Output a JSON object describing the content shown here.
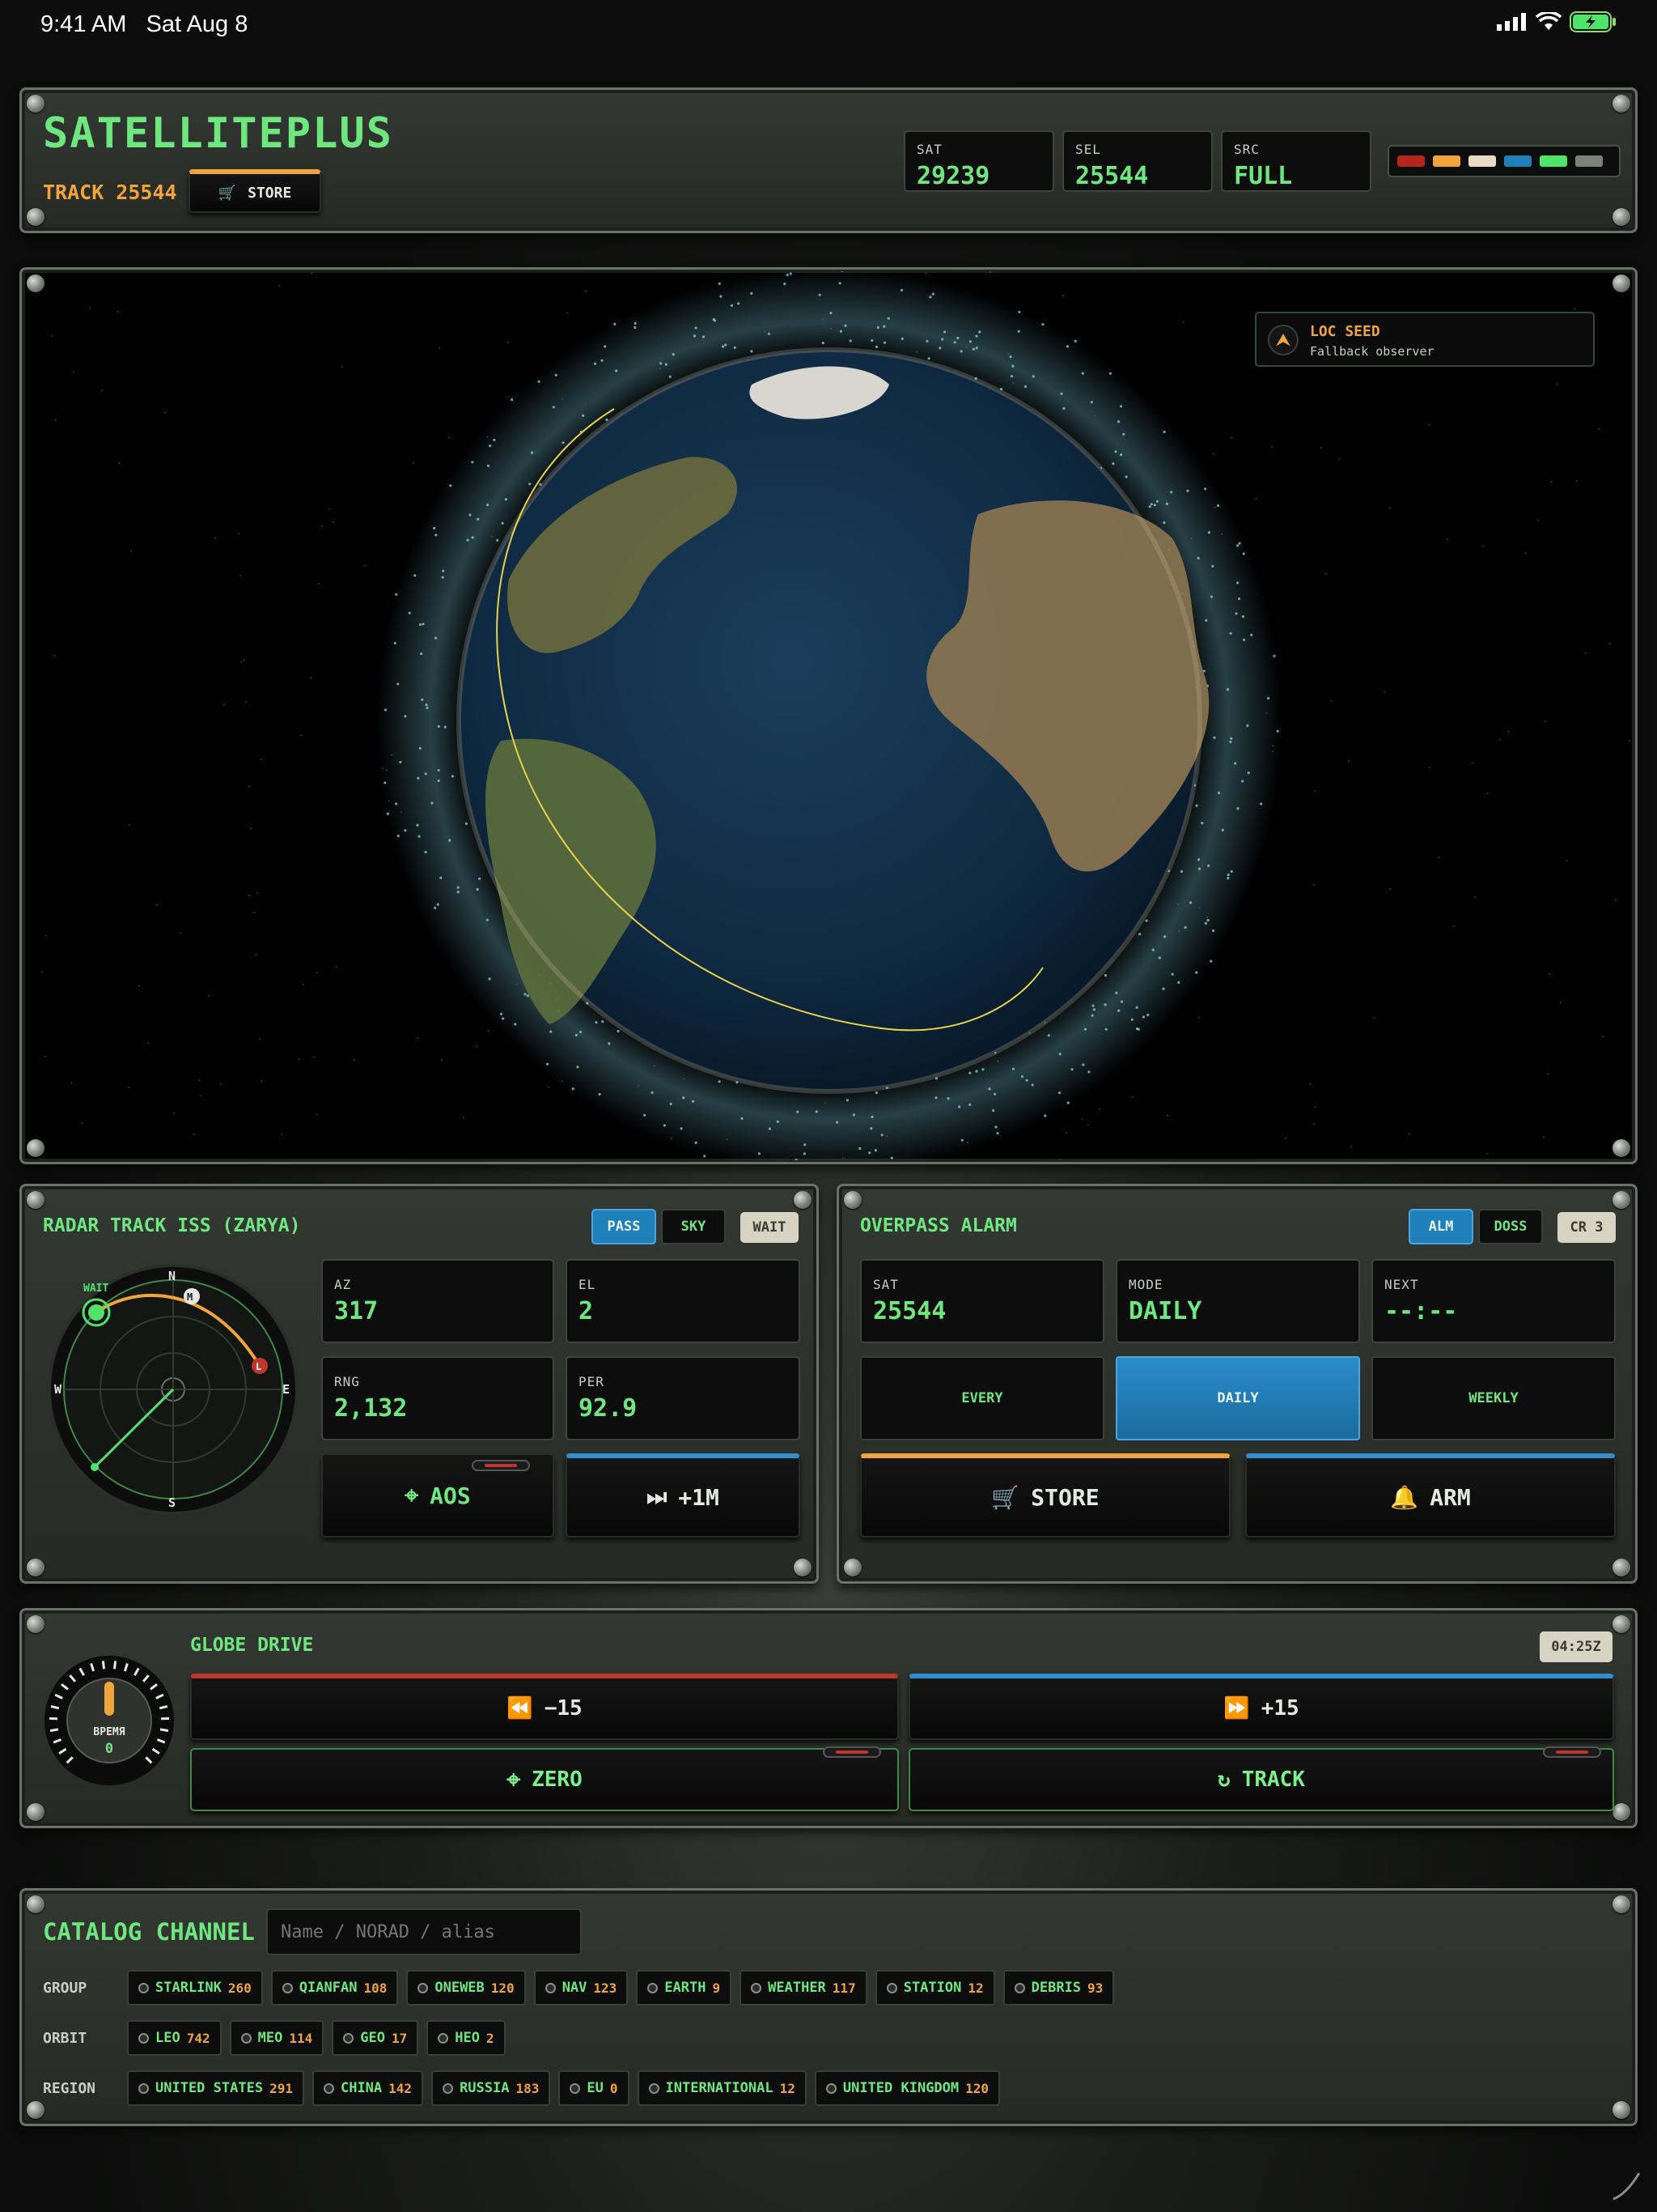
{
  "status": {
    "time": "9:41 AM",
    "date": "Sat Aug 8"
  },
  "header": {
    "app_title": "SATELLITEPLUS",
    "track_label": "TRACK 25544",
    "store_label": "STORE",
    "stats": [
      {
        "label": "SAT",
        "value": "29239"
      },
      {
        "label": "SEL",
        "value": "25544"
      },
      {
        "label": "SRC",
        "value": "FULL"
      }
    ],
    "palette": [
      "#b3261e",
      "#f0a43c",
      "#e7dcc1",
      "#1f7fb8",
      "#4fe36a",
      "#7b8378"
    ]
  },
  "globe": {
    "loc_title": "LOC SEED",
    "loc_sub": "Fallback observer"
  },
  "radar": {
    "title": "RADAR TRACK ISS (ZARYA)",
    "tabs": [
      "PASS",
      "SKY"
    ],
    "status_badge": "WAIT",
    "compass": {
      "n": "N",
      "e": "E",
      "s": "S",
      "w": "W",
      "marker_m": "M",
      "marker_l": "L",
      "wait_label": "WAIT"
    },
    "readouts": [
      {
        "label": "AZ",
        "value": "317"
      },
      {
        "label": "EL",
        "value": "2"
      },
      {
        "label": "RNG",
        "value": "2,132"
      },
      {
        "label": "PER",
        "value": "92.9"
      }
    ],
    "aos_label": "AOS",
    "plus1m_label": "+1M"
  },
  "alarm": {
    "title": "OVERPASS ALARM",
    "tabs": [
      "ALM",
      "DOSS"
    ],
    "badge": "CR 3",
    "readouts": [
      {
        "label": "SAT",
        "value": "25544"
      },
      {
        "label": "MODE",
        "value": "DAILY"
      },
      {
        "label": "NEXT",
        "value": "--:--"
      }
    ],
    "modes": [
      "EVERY",
      "DAILY",
      "WEEKLY"
    ],
    "store_label": "STORE",
    "arm_label": "ARM"
  },
  "drive": {
    "title": "GLOBE DRIVE",
    "time_badge": "04:25Z",
    "knob_label": "ВРЕМЯ",
    "knob_value": "0",
    "back_label": "−15",
    "fwd_label": "+15",
    "zero_label": "ZERO",
    "track_label": "TRACK"
  },
  "catalog": {
    "title": "CATALOG CHANNEL",
    "search_placeholder": "Name / NORAD / alias",
    "groups_label": "GROUP",
    "groups": [
      {
        "name": "STARLINK",
        "count": "260"
      },
      {
        "name": "QIANFAN",
        "count": "108"
      },
      {
        "name": "ONEWEB",
        "count": "120"
      },
      {
        "name": "NAV",
        "count": "123"
      },
      {
        "name": "EARTH",
        "count": "9"
      },
      {
        "name": "WEATHER",
        "count": "117"
      },
      {
        "name": "STATION",
        "count": "12"
      },
      {
        "name": "DEBRIS",
        "count": "93"
      }
    ],
    "orbit_label": "ORBIT",
    "orbits": [
      {
        "name": "LEO",
        "count": "742"
      },
      {
        "name": "MEO",
        "count": "114"
      },
      {
        "name": "GEO",
        "count": "17"
      },
      {
        "name": "HEO",
        "count": "2"
      }
    ],
    "region_label": "REGION",
    "regions": [
      {
        "name": "UNITED STATES",
        "count": "291"
      },
      {
        "name": "CHINA",
        "count": "142"
      },
      {
        "name": "RUSSIA",
        "count": "183"
      },
      {
        "name": "EU",
        "count": "0"
      },
      {
        "name": "INTERNATIONAL",
        "count": "12"
      },
      {
        "name": "UNITED KINGDOM",
        "count": "120"
      }
    ]
  }
}
